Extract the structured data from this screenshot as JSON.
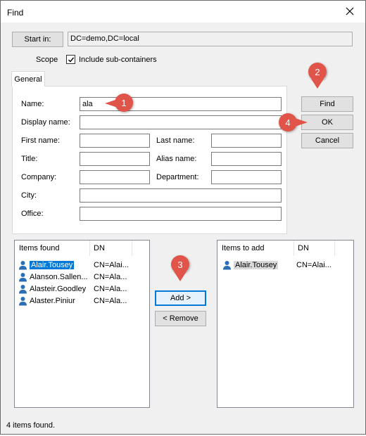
{
  "window": {
    "title": "Find"
  },
  "start_in": {
    "button_label": "Start in:",
    "value": "DC=demo,DC=local"
  },
  "scope": {
    "label": "Scope",
    "checkbox_label": "Include sub-containers",
    "checked": true
  },
  "tabs": [
    {
      "label": "General"
    }
  ],
  "form": {
    "name": {
      "label": "Name:",
      "value": "ala"
    },
    "display_name": {
      "label": "Display name:",
      "value": ""
    },
    "first_name": {
      "label": "First name:",
      "value": ""
    },
    "last_name": {
      "label": "Last name:",
      "value": ""
    },
    "title": {
      "label": "Title:",
      "value": ""
    },
    "alias_name": {
      "label": "Alias name:",
      "value": ""
    },
    "company": {
      "label": "Company:",
      "value": ""
    },
    "department": {
      "label": "Department:",
      "value": ""
    },
    "city": {
      "label": "City:",
      "value": ""
    },
    "office": {
      "label": "Office:",
      "value": ""
    }
  },
  "buttons": {
    "find": "Find",
    "ok": "OK",
    "cancel": "Cancel",
    "add": "Add >",
    "remove": "< Remove"
  },
  "found_list": {
    "columns": [
      "Items found",
      "DN"
    ],
    "rows": [
      {
        "name": "Alair.Tousey",
        "dn": "CN=Alai...",
        "selected": true
      },
      {
        "name": "Alanson.Sallen...",
        "dn": "CN=Ala..."
      },
      {
        "name": "Alasteir.Goodley",
        "dn": "CN=Ala..."
      },
      {
        "name": "Alaster.Piniur",
        "dn": "CN=Ala..."
      }
    ]
  },
  "add_list": {
    "columns": [
      "Items to add",
      "DN"
    ],
    "rows": [
      {
        "name": "Alair.Tousey",
        "dn": "CN=Alai..."
      }
    ]
  },
  "callouts": [
    "1",
    "2",
    "3",
    "4"
  ],
  "status": {
    "text": "4 items found."
  },
  "colors": {
    "accent": "#0078d7",
    "callout": "#e0544a"
  }
}
